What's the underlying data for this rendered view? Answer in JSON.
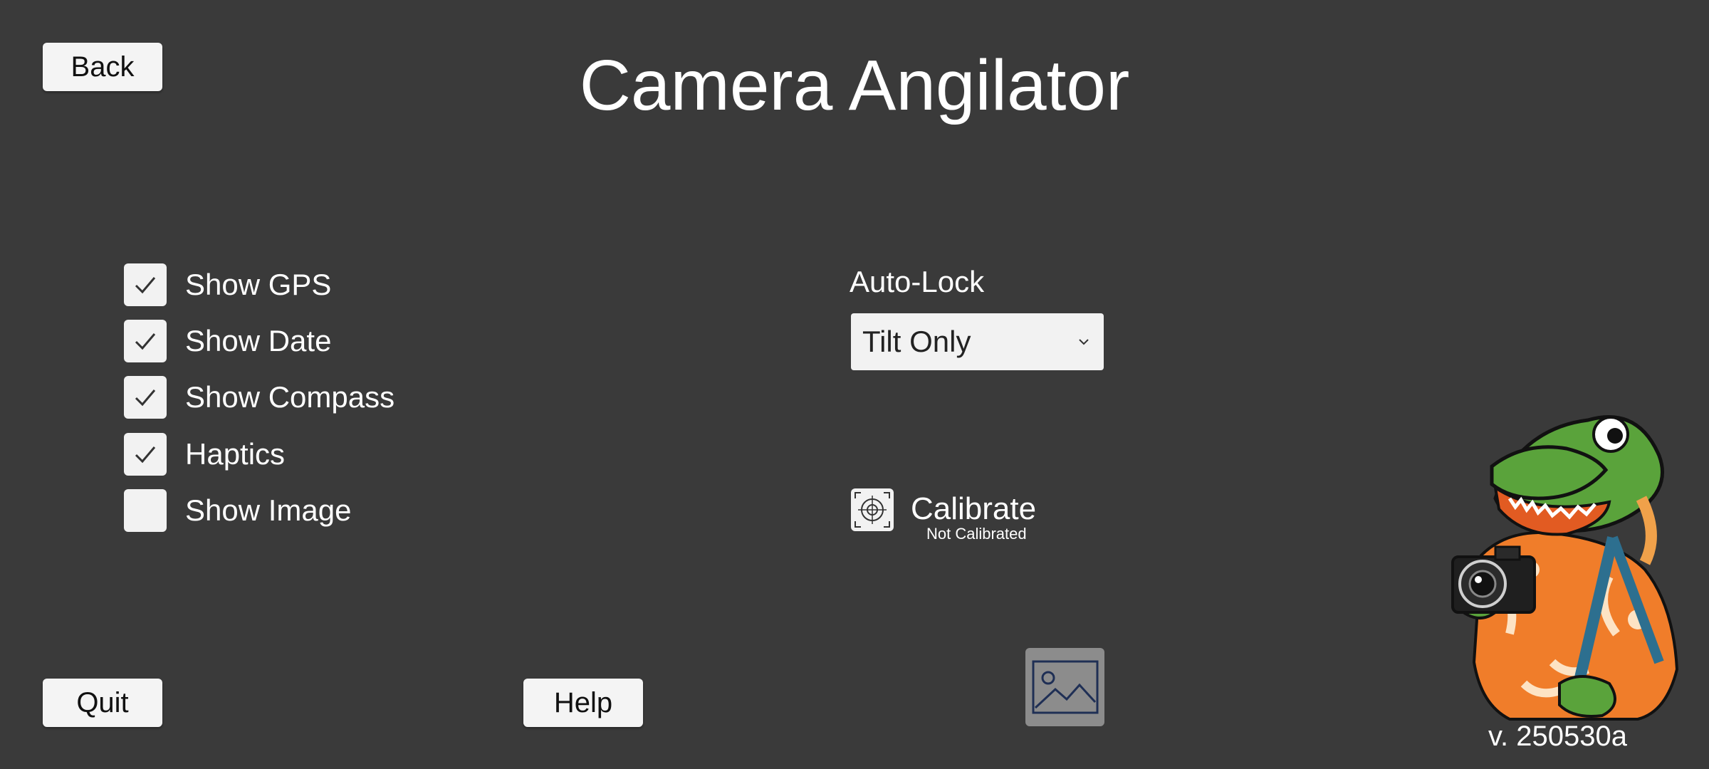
{
  "header": {
    "title": "Camera Angilator",
    "back_label": "Back"
  },
  "options": [
    {
      "label": "Show GPS",
      "checked": true
    },
    {
      "label": "Show Date",
      "checked": true
    },
    {
      "label": "Show Compass",
      "checked": true
    },
    {
      "label": "Haptics",
      "checked": true
    },
    {
      "label": "Show Image",
      "checked": false
    }
  ],
  "auto_lock": {
    "label": "Auto-Lock",
    "selected": "Tilt Only"
  },
  "calibrate": {
    "label": "Calibrate",
    "status": "Not Calibrated",
    "icon": "crosshair-icon"
  },
  "footer": {
    "quit_label": "Quit",
    "help_label": "Help",
    "image_icon": "image-icon",
    "version": "v. 250530a"
  },
  "colors": {
    "background": "#3a3a3a",
    "button_bg": "#f4f4f4",
    "image_button_bg": "#8c8c8c",
    "icon_navy": "#1f2f55"
  }
}
